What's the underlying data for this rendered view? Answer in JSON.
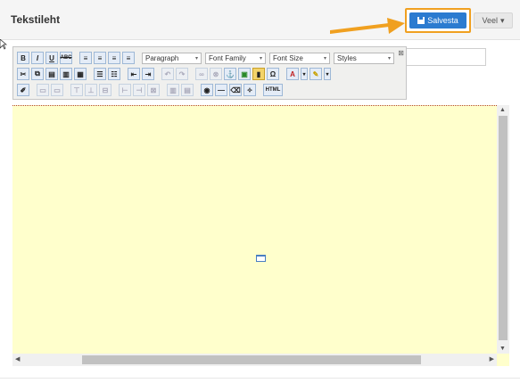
{
  "header": {
    "title": "Tekstileht"
  },
  "actions": {
    "save_label": "Salvesta",
    "more_label": "Veel"
  },
  "toolbar": {
    "row1": {
      "bold": "B",
      "italic": "I",
      "underline": "U",
      "strike": "ABC",
      "format_select": "Paragraph",
      "font_family_select": "Font Family",
      "font_size_select": "Font Size",
      "styles_select": "Styles"
    },
    "row2": {
      "omega": "Ω",
      "text_color": "A"
    },
    "row3": {
      "html": "HTML"
    }
  },
  "colors": {
    "accent": "#2b7bd0",
    "highlight": "#f0a020",
    "editor_bg": "#ffffcc"
  }
}
